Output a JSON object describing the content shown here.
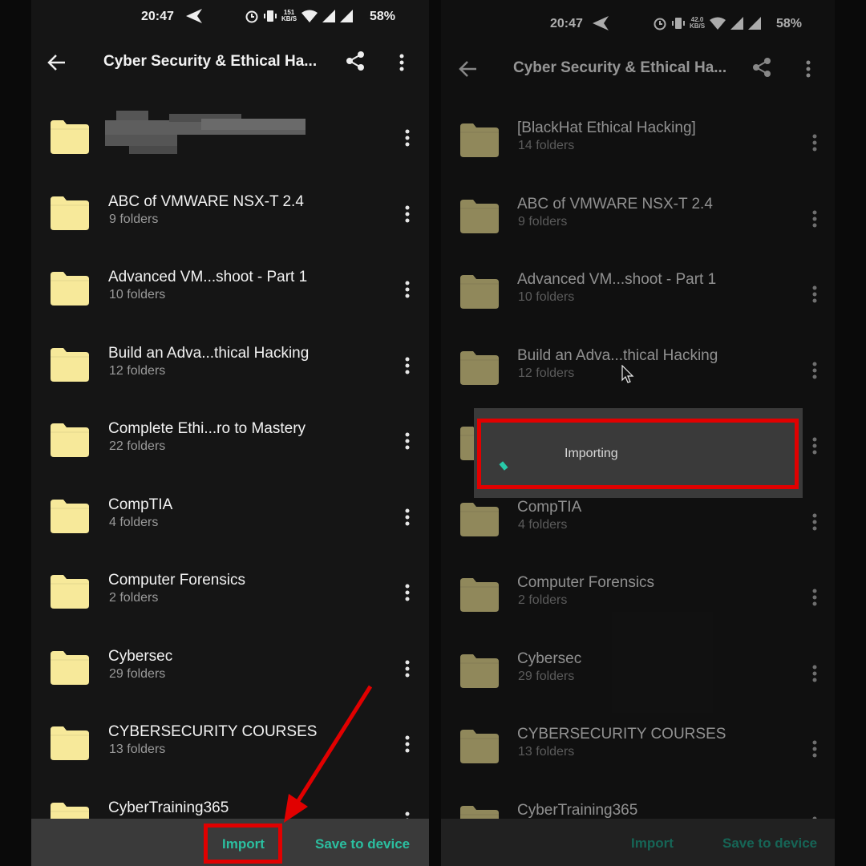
{
  "status_bar": {
    "left": {
      "time": "20:47",
      "net_speed_value": "151",
      "net_speed_unit": "KB/S",
      "battery": "58%"
    },
    "right": {
      "time": "20:47",
      "net_speed_value": "42.0",
      "net_speed_unit": "KB/S",
      "battery": "58%"
    }
  },
  "toolbar": {
    "title": "Cyber Security & Ethical Ha...",
    "back_icon": "arrow-left-icon",
    "share_icon": "share-icon",
    "more_icon": "more-vert-icon"
  },
  "left_list": [
    {
      "name": "",
      "count": "",
      "blurred": true
    },
    {
      "name": "ABC of VMWARE NSX-T 2.4",
      "count": "9 folders"
    },
    {
      "name": "Advanced VM...shoot - Part 1",
      "count": "10 folders"
    },
    {
      "name": "Build an Adva...thical Hacking",
      "count": "12 folders"
    },
    {
      "name": "Complete Ethi...ro to Mastery",
      "count": "22 folders"
    },
    {
      "name": "CompTIA",
      "count": "4 folders"
    },
    {
      "name": "Computer Forensics",
      "count": "2 folders"
    },
    {
      "name": "Cybersec",
      "count": "29 folders"
    },
    {
      "name": "CYBERSECURITY COURSES",
      "count": "13 folders"
    },
    {
      "name": "CyberTraining365",
      "count": ""
    }
  ],
  "right_list": [
    {
      "name": "[BlackHat Ethical Hacking]",
      "count": "14 folders"
    },
    {
      "name": "ABC of VMWARE NSX-T 2.4",
      "count": "9 folders"
    },
    {
      "name": "Advanced VM...shoot - Part 1",
      "count": "10 folders"
    },
    {
      "name": "Build an Adva...thical Hacking",
      "count": "12 folders"
    },
    {
      "name": "",
      "count": ""
    },
    {
      "name": "CompTIA",
      "count": "4 folders"
    },
    {
      "name": "Computer Forensics",
      "count": "2 folders"
    },
    {
      "name": "Cybersec",
      "count": "29 folders"
    },
    {
      "name": "CYBERSECURITY COURSES",
      "count": "13 folders"
    },
    {
      "name": "CyberTraining365",
      "count": ""
    }
  ],
  "bottom_bar": {
    "import_label": "Import",
    "save_label": "Save to device"
  },
  "dialog": {
    "message": "Importing"
  },
  "colors": {
    "accent": "#2bbfa0",
    "highlight": "#e10000",
    "folder": "#f7e99a"
  }
}
